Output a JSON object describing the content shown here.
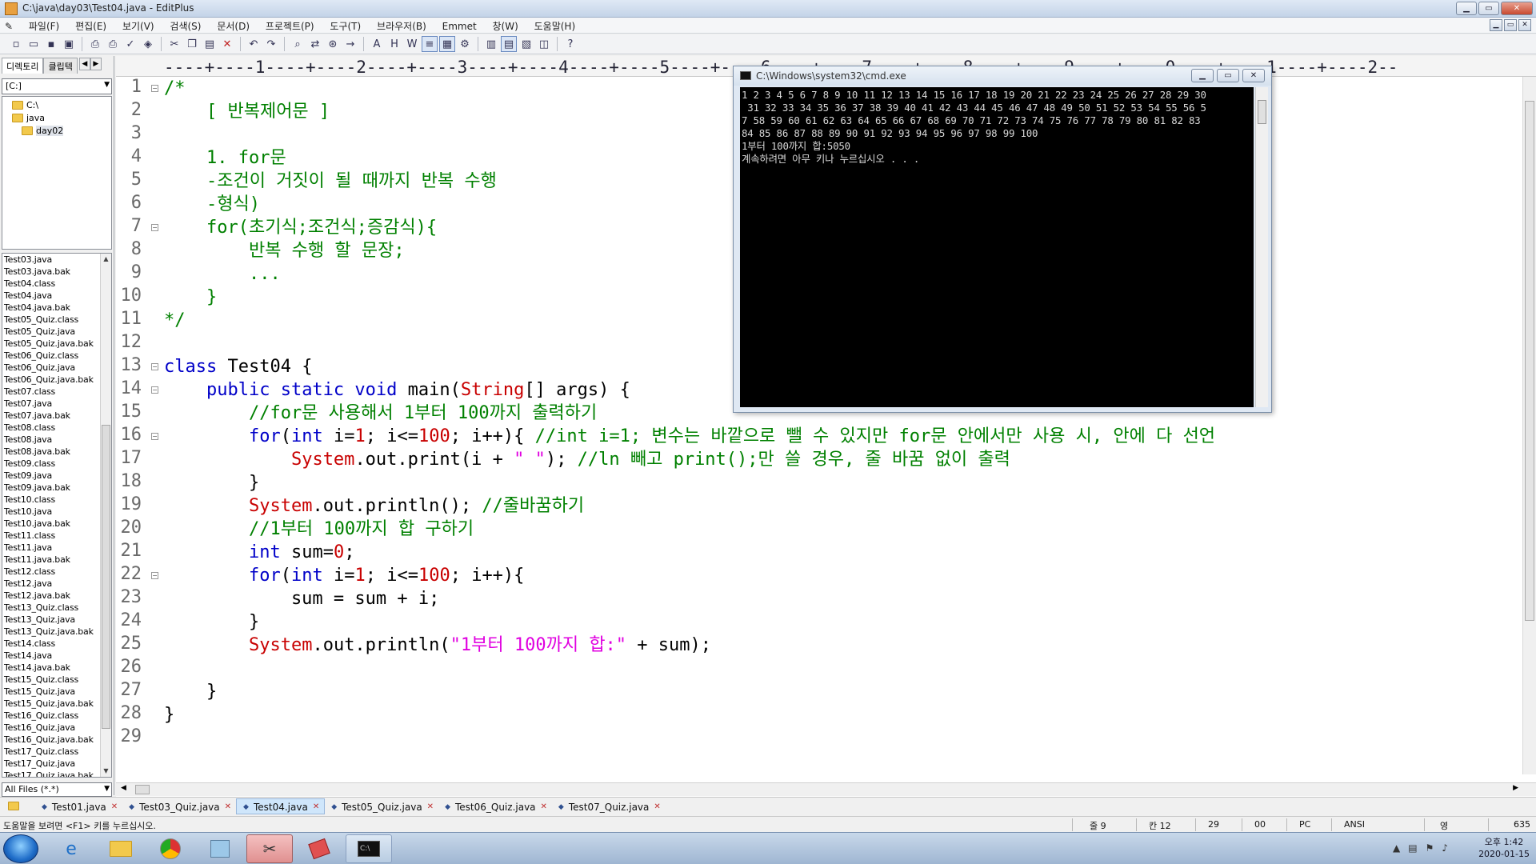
{
  "window": {
    "title": "C:\\java\\day03\\Test04.java - EditPlus",
    "min_label": "▁",
    "max_label": "▭",
    "close_label": "✕"
  },
  "menu": [
    "파일(F)",
    "편집(E)",
    "보기(V)",
    "검색(S)",
    "문서(D)",
    "프로젝트(P)",
    "도구(T)",
    "브라우저(B)",
    "Emmet",
    "창(W)",
    "도움말(H)"
  ],
  "left_panel": {
    "tabs": [
      "디렉토리",
      "클립텍"
    ],
    "drive": "[C:]",
    "dirs": [
      "C:\\",
      "java",
      "day02"
    ],
    "files": [
      "Test03.java",
      "Test03.java.bak",
      "Test04.class",
      "Test04.java",
      "Test04.java.bak",
      "Test05_Quiz.class",
      "Test05_Quiz.java",
      "Test05_Quiz.java.bak",
      "Test06_Quiz.class",
      "Test06_Quiz.java",
      "Test06_Quiz.java.bak",
      "Test07.class",
      "Test07.java",
      "Test07.java.bak",
      "Test08.class",
      "Test08.java",
      "Test08.java.bak",
      "Test09.class",
      "Test09.java",
      "Test09.java.bak",
      "Test10.class",
      "Test10.java",
      "Test10.java.bak",
      "Test11.class",
      "Test11.java",
      "Test11.java.bak",
      "Test12.class",
      "Test12.java",
      "Test12.java.bak",
      "Test13_Quiz.class",
      "Test13_Quiz.java",
      "Test13_Quiz.java.bak",
      "Test14.class",
      "Test14.java",
      "Test14.java.bak",
      "Test15_Quiz.class",
      "Test15_Quiz.java",
      "Test15_Quiz.java.bak",
      "Test16_Quiz.class",
      "Test16_Quiz.java",
      "Test16_Quiz.java.bak",
      "Test17_Quiz.class",
      "Test17_Quiz.java",
      "Test17_Quiz.java.bak"
    ],
    "filter": "All Files (*.*)"
  },
  "ruler": "----+----1----+----2----+----3----+----4----+----5----+----6----+----7----+----8----+----9----+----0----+----1----+----2--",
  "line_numbers": [
    "1",
    "2",
    "3",
    "4",
    "5",
    "6",
    "7",
    "8",
    "9",
    "10",
    "11",
    "12",
    "13",
    "14",
    "15",
    "16",
    "17",
    "18",
    "19",
    "20",
    "21",
    "22",
    "23",
    "24",
    "25",
    "26",
    "27",
    "28",
    "29"
  ],
  "code": {
    "l1": "/*",
    "l2": "    [ 반복제어문 ]",
    "l4": "    1. for문",
    "l5": "    -조건이 거짓이 될 때까지 반복 수행",
    "l6": "    -형식)",
    "l7": "    for(초기식;조건식;증감식){",
    "l8": "        반복 수행 할 문장;",
    "l9": "        ...",
    "l10": "    }",
    "l11": "*/",
    "l13_kw": "class",
    "l13_rest": " Test04 {",
    "l14_pre": "    ",
    "l14_kw": "public static void",
    "l14_mid": " main(",
    "l14_cls": "String",
    "l14_end": "[] args) {",
    "l15": "        //for문 사용해서 1부터 100까지 출력하기",
    "l16_pre": "        ",
    "l16_kw1": "for",
    "l16_a": "(",
    "l16_kw2": "int",
    "l16_b": " i=",
    "l16_n1": "1",
    "l16_c": "; i<=",
    "l16_n2": "100",
    "l16_d": "; i++){ ",
    "l16_com": "//int i=1; 변수는 바깥으로 뺄 수 있지만 for문 안에서만 사용 시, 안에 다 선언",
    "l17_pre": "            ",
    "l17_cls": "System",
    "l17_a": ".out.print(i + ",
    "l17_str": "\" \"",
    "l17_b": "); ",
    "l17_com": "//ln 빼고 print();만 쓸 경우, 줄 바꿈 없이 출력",
    "l18": "        }",
    "l19_pre": "        ",
    "l19_cls": "System",
    "l19_a": ".out.println(); ",
    "l19_com": "//줄바꿈하기",
    "l20": "        //1부터 100까지 합 구하기",
    "l21_pre": "        ",
    "l21_kw": "int",
    "l21_a": " sum=",
    "l21_n": "0",
    "l21_b": ";",
    "l22_pre": "        ",
    "l22_kw1": "for",
    "l22_a": "(",
    "l22_kw2": "int",
    "l22_b": " i=",
    "l22_n1": "1",
    "l22_c": "; i<=",
    "l22_n2": "100",
    "l22_d": "; i++){",
    "l23": "            sum = sum + i;",
    "l24": "        }",
    "l25_pre": "        ",
    "l25_cls": "System",
    "l25_a": ".out.println(",
    "l25_str": "\"1부터 100까지 합:\"",
    "l25_b": " + sum);",
    "l27": "    }",
    "l28": "}"
  },
  "doc_tabs": [
    "Test01.java",
    "Test03_Quiz.java",
    "Test04.java",
    "Test05_Quiz.java",
    "Test06_Quiz.java",
    "Test07_Quiz.java"
  ],
  "status": {
    "help": "도움말을 보려면 <F1> 키를 누르십시오.",
    "line": "줄 9",
    "col": "칸 12",
    "lines_total": "29",
    "code": "00",
    "mode": "PC",
    "encoding": "ANSI",
    "ime": "영",
    "extra": "635"
  },
  "cmd": {
    "title": "C:\\Windows\\system32\\cmd.exe",
    "lines": [
      "1 2 3 4 5 6 7 8 9 10 11 12 13 14 15 16 17 18 19 20 21 22 23 24 25 26 27 28 29 30",
      " 31 32 33 34 35 36 37 38 39 40 41 42 43 44 45 46 47 48 49 50 51 52 53 54 55 56 5",
      "7 58 59 60 61 62 63 64 65 66 67 68 69 70 71 72 73 74 75 76 77 78 79 80 81 82 83",
      "84 85 86 87 88 89 90 91 92 93 94 95 96 97 98 99 100",
      "1부터 100까지 합:5050",
      "계속하려면 아무 키나 누르십시오 . . ."
    ]
  },
  "taskbar": {
    "time": "오후 1:42",
    "date": "2020-01-15"
  }
}
